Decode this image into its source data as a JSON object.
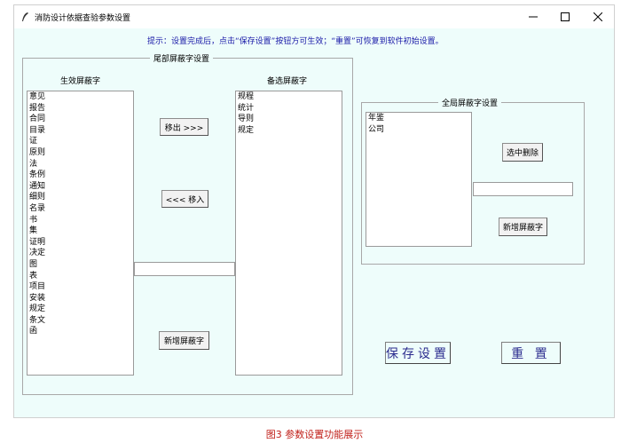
{
  "window": {
    "title": "消防设计依据查验参数设置",
    "minimize_icon": "minimize-icon",
    "maximize_icon": "maximize-icon",
    "close_icon": "close-icon"
  },
  "hint": "提示：设置完成后，点击“保存设置”按钮方可生效；“重置”可恢复到软件初始设置。",
  "tail_group": {
    "title": "尾部屏蔽字设置",
    "active_label": "生效屏蔽字",
    "active_items": [
      "意见",
      "报告",
      "合同",
      "目录",
      "证",
      "原则",
      "法",
      "条例",
      "通知",
      "细则",
      "名录",
      "书",
      "集",
      "证明",
      "决定",
      "图",
      "表",
      "项目",
      "安装",
      "规定",
      "条文",
      "函"
    ],
    "candidate_label": "备选屏蔽字",
    "candidate_items": [
      "规程",
      "统计",
      "导则",
      "规定"
    ],
    "move_out_button": "移出 >>>",
    "move_in_button": "<<< 移入",
    "add_button": "新增屏蔽字",
    "new_entry_value": ""
  },
  "global_group": {
    "title": "全局屏蔽字设置",
    "items": [
      "年鉴",
      "公司"
    ],
    "delete_button": "选中删除",
    "add_button": "新增屏蔽字",
    "new_entry_value": ""
  },
  "save_button": "保存设置",
  "reset_button": "重 置",
  "caption": "图3  参数设置功能展示"
}
